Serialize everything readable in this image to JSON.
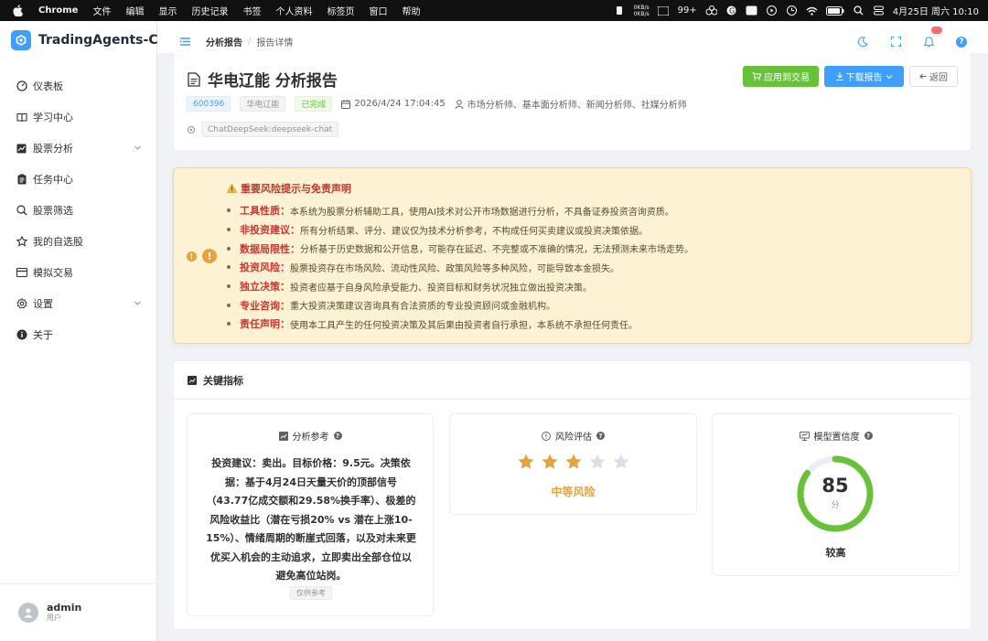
{
  "menubar": {
    "app": "Chrome",
    "items": [
      "文件",
      "编辑",
      "显示",
      "历史记录",
      "书签",
      "个人资料",
      "标签页",
      "窗口",
      "帮助"
    ],
    "net_up": "0KB/s",
    "net_down": "0KB/s",
    "notif_count": "99+",
    "datetime": "4月25日 周六  10:10"
  },
  "brand": {
    "name": "TradingAgents-CN",
    "color": "#409eff"
  },
  "sidebar": {
    "items": [
      {
        "label": "仪表板",
        "icon": "dashboard-icon"
      },
      {
        "label": "学习中心",
        "icon": "book-icon"
      },
      {
        "label": "股票分析",
        "icon": "chart-icon",
        "expandable": true
      },
      {
        "label": "任务中心",
        "icon": "clipboard-icon"
      },
      {
        "label": "股票筛选",
        "icon": "search-icon"
      },
      {
        "label": "我的自选股",
        "icon": "star-icon"
      },
      {
        "label": "模拟交易",
        "icon": "card-icon"
      },
      {
        "label": "设置",
        "icon": "gear-icon",
        "expandable": true
      },
      {
        "label": "关于",
        "icon": "info-icon"
      }
    ],
    "user": {
      "name": "admin",
      "role": "用户"
    }
  },
  "header": {
    "breadcrumb": {
      "parent": "分析报告",
      "separator": "/",
      "current": "报告详情"
    }
  },
  "report": {
    "title": "华电辽能 分析报告",
    "buttons": {
      "apply": "应用到交易",
      "download": "下载报告",
      "back": "返回"
    },
    "tags": {
      "code": "600396",
      "name": "华电辽能",
      "status": "已完成"
    },
    "datetime": "2026/4/24 17:04:45",
    "analysts": "市场分析师、基本面分析师、新闻分析师、社媒分析师",
    "model": "ChatDeepSeek:deepseek-chat"
  },
  "risk": {
    "title": "重要风险提示与免责声明",
    "items": [
      {
        "key": "工具性质",
        "text": "本系统为股票分析辅助工具，使用AI技术对公开市场数据进行分析，不具备证券投资咨询资质。"
      },
      {
        "key": "非投资建议",
        "text": "所有分析结果、评分、建议仅为技术分析参考，不构成任何买卖建议或投资决策依据。"
      },
      {
        "key": "数据局限性",
        "text": "分析基于历史数据和公开信息，可能存在延迟、不完整或不准确的情况，无法预测未来市场走势。"
      },
      {
        "key": "投资风险",
        "text": "股票投资存在市场风险、流动性风险、政策风险等多种风险，可能导致本金损失。"
      },
      {
        "key": "独立决策",
        "text": "投资者应基于自身风险承受能力、投资目标和财务状况独立做出投资决策。"
      },
      {
        "key": "专业咨询",
        "text": "重大投资决策建议咨询具有合法资质的专业投资顾问或金融机构。"
      },
      {
        "key": "责任声明",
        "text": "使用本工具产生的任何投资决策及其后果由投资者自行承担，本系统不承担任何责任。"
      }
    ],
    "colon": "："
  },
  "metrics": {
    "title": "关键指标",
    "analysis": {
      "title": "分析参考",
      "text": "投资建议：卖出。目标价格：9.5元。决策依据：基于4月24日天量天价的顶部信号（43.77亿成交额和29.58%换手率）、极差的风险收益比（潜在亏损20% vs 潜在上涨10-15%）、情绪周期的断崖式回落，以及对未来更优买入机会的主动追求，立即卖出全部仓位以避免高位站岗。",
      "badge": "仅供参考"
    },
    "risk": {
      "title": "风险评估",
      "stars": 3,
      "max_stars": 5,
      "level": "中等风险",
      "star_color": "#e6a23c"
    },
    "confidence": {
      "title": "模型置信度",
      "score": "85",
      "score_value": 85,
      "unit": "分",
      "level": "较高",
      "color": "#67c23a"
    }
  }
}
